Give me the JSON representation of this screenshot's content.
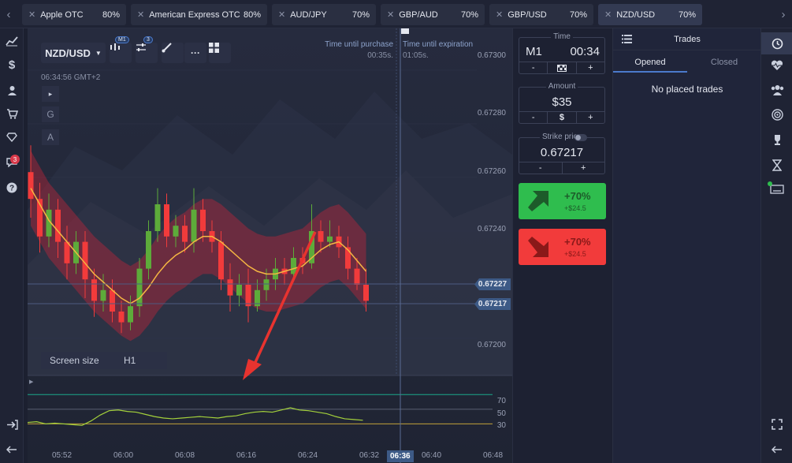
{
  "tabs": [
    {
      "name": "Apple OTC",
      "pct": "80%"
    },
    {
      "name": "American Express OTC",
      "pct": "80%"
    },
    {
      "name": "AUD/JPY",
      "pct": "70%"
    },
    {
      "name": "GBP/AUD",
      "pct": "70%"
    },
    {
      "name": "GBP/USD",
      "pct": "70%"
    },
    {
      "name": "NZD/USD",
      "pct": "70%",
      "active": true
    }
  ],
  "nav": {
    "prev": "‹",
    "next": "›"
  },
  "toolbar": {
    "asset": "NZD/USD",
    "timeframe_badge": "M1",
    "indicator_badge": "3",
    "more": "···"
  },
  "chart": {
    "server_time": "06:34:56 GMT+2",
    "side_buttons": [
      "▸",
      "G",
      "A"
    ],
    "time_until_purchase_label": "Time until purchase",
    "time_until_purchase_value": "00:35s.",
    "time_until_expiration_label": "Time until expiration",
    "time_until_expiration_value": "01:05s.",
    "price_ticks": [
      "0.67300",
      "0.67280",
      "0.67260",
      "0.67240",
      "0.67220",
      "0.67200"
    ],
    "price_tag_1": "0.67227",
    "price_tag_2": "0.67217",
    "screen_size_label": "Screen size",
    "screen_size_value": "H1",
    "osc_ticks": [
      "70",
      "50",
      "30"
    ],
    "time_ticks": [
      "05:52",
      "06:00",
      "06:08",
      "06:16",
      "06:24",
      "06:32",
      "06:36",
      "06:40",
      "06:48"
    ]
  },
  "order": {
    "time_label": "Time",
    "time_frame": "M1",
    "time_value": "00:34",
    "amount_label": "Amount",
    "amount_value": "$35",
    "strike_label": "Strike price",
    "strike_value": "0.67217",
    "minus": "-",
    "plus": "+",
    "dollar": "$",
    "up_pct": "+70%",
    "up_amt": "+$24.5",
    "down_pct": "+70%",
    "down_amt": "+$24.5",
    "colors": {
      "up": "#2fbd4e",
      "down": "#f23b3b"
    }
  },
  "trades": {
    "title": "Trades",
    "tab_opened": "Opened",
    "tab_closed": "Closed",
    "empty_text": "No placed trades"
  },
  "leftbar_badge": "3",
  "chart_data": {
    "type": "candlestick",
    "note_units": "price",
    "ylim": [
      0.67195,
      0.67305
    ],
    "candles": [
      {
        "o": 0.67262,
        "c": 0.67252,
        "h": 0.67272,
        "l": 0.67245
      },
      {
        "o": 0.67252,
        "c": 0.67238,
        "h": 0.67258,
        "l": 0.67232
      },
      {
        "o": 0.67238,
        "c": 0.67248,
        "h": 0.67254,
        "l": 0.67234
      },
      {
        "o": 0.67248,
        "c": 0.67236,
        "h": 0.67252,
        "l": 0.6723
      },
      {
        "o": 0.67236,
        "c": 0.67228,
        "h": 0.67242,
        "l": 0.67222
      },
      {
        "o": 0.67228,
        "c": 0.67236,
        "h": 0.6724,
        "l": 0.67224
      },
      {
        "o": 0.67236,
        "c": 0.67222,
        "h": 0.6724,
        "l": 0.67215
      },
      {
        "o": 0.67222,
        "c": 0.67214,
        "h": 0.67226,
        "l": 0.67208
      },
      {
        "o": 0.67214,
        "c": 0.67218,
        "h": 0.67224,
        "l": 0.6721
      },
      {
        "o": 0.67218,
        "c": 0.6721,
        "h": 0.67222,
        "l": 0.67206
      },
      {
        "o": 0.6721,
        "c": 0.67206,
        "h": 0.67214,
        "l": 0.67202
      },
      {
        "o": 0.67206,
        "c": 0.67212,
        "h": 0.67216,
        "l": 0.67203
      },
      {
        "o": 0.67212,
        "c": 0.67226,
        "h": 0.6723,
        "l": 0.67208
      },
      {
        "o": 0.67226,
        "c": 0.6724,
        "h": 0.67244,
        "l": 0.67222
      },
      {
        "o": 0.6724,
        "c": 0.6725,
        "h": 0.67256,
        "l": 0.67236
      },
      {
        "o": 0.6725,
        "c": 0.67238,
        "h": 0.67254,
        "l": 0.67234
      },
      {
        "o": 0.67238,
        "c": 0.67242,
        "h": 0.67246,
        "l": 0.67234
      },
      {
        "o": 0.67242,
        "c": 0.67236,
        "h": 0.67246,
        "l": 0.67232
      },
      {
        "o": 0.67236,
        "c": 0.67248,
        "h": 0.67256,
        "l": 0.67232
      },
      {
        "o": 0.67248,
        "c": 0.6724,
        "h": 0.67252,
        "l": 0.67236
      },
      {
        "o": 0.6724,
        "c": 0.67236,
        "h": 0.67244,
        "l": 0.67232
      },
      {
        "o": 0.67236,
        "c": 0.67222,
        "h": 0.6724,
        "l": 0.67218
      },
      {
        "o": 0.67222,
        "c": 0.67216,
        "h": 0.67228,
        "l": 0.6721
      },
      {
        "o": 0.67216,
        "c": 0.6722,
        "h": 0.67224,
        "l": 0.67212
      },
      {
        "o": 0.6722,
        "c": 0.67212,
        "h": 0.67226,
        "l": 0.67206
      },
      {
        "o": 0.67212,
        "c": 0.67218,
        "h": 0.67222,
        "l": 0.6721
      },
      {
        "o": 0.67218,
        "c": 0.67222,
        "h": 0.67226,
        "l": 0.67214
      },
      {
        "o": 0.67222,
        "c": 0.67226,
        "h": 0.6723,
        "l": 0.67218
      },
      {
        "o": 0.67226,
        "c": 0.67224,
        "h": 0.6723,
        "l": 0.6722
      },
      {
        "o": 0.67224,
        "c": 0.6723,
        "h": 0.67234,
        "l": 0.67222
      },
      {
        "o": 0.6723,
        "c": 0.67228,
        "h": 0.67234,
        "l": 0.67224
      },
      {
        "o": 0.67228,
        "c": 0.6724,
        "h": 0.6725,
        "l": 0.67226
      },
      {
        "o": 0.6724,
        "c": 0.67236,
        "h": 0.67244,
        "l": 0.67232
      },
      {
        "o": 0.67236,
        "c": 0.67238,
        "h": 0.67244,
        "l": 0.67234
      },
      {
        "o": 0.67238,
        "c": 0.67234,
        "h": 0.67242,
        "l": 0.6723
      },
      {
        "o": 0.67234,
        "c": 0.67226,
        "h": 0.67238,
        "l": 0.67222
      },
      {
        "o": 0.67226,
        "c": 0.6722,
        "h": 0.6723,
        "l": 0.67218
      },
      {
        "o": 0.6722,
        "c": 0.67214,
        "h": 0.67226,
        "l": 0.6721
      }
    ],
    "ma_series": [
      0.67256,
      0.6725,
      0.67244,
      0.6724,
      0.67236,
      0.67232,
      0.67228,
      0.67224,
      0.67221,
      0.67218,
      0.67215,
      0.67213,
      0.67215,
      0.67219,
      0.67224,
      0.67228,
      0.67231,
      0.67233,
      0.67236,
      0.67238,
      0.67238,
      0.67236,
      0.67233,
      0.6723,
      0.67227,
      0.67225,
      0.67224,
      0.67224,
      0.67225,
      0.67226,
      0.67227,
      0.6723,
      0.67233,
      0.67235,
      0.67236,
      0.67233,
      0.67229,
      0.67225
    ],
    "osc_series": [
      32,
      33,
      30,
      31,
      30,
      29,
      28,
      34,
      42,
      48,
      49,
      47,
      46,
      43,
      40,
      38,
      37,
      38,
      39,
      40,
      39,
      38,
      40,
      41,
      44,
      46,
      47,
      46,
      49,
      52,
      49,
      48,
      46,
      44,
      40,
      37,
      36,
      35
    ],
    "osc_levels": [
      70,
      50,
      30
    ],
    "annotation": "red arrow"
  }
}
